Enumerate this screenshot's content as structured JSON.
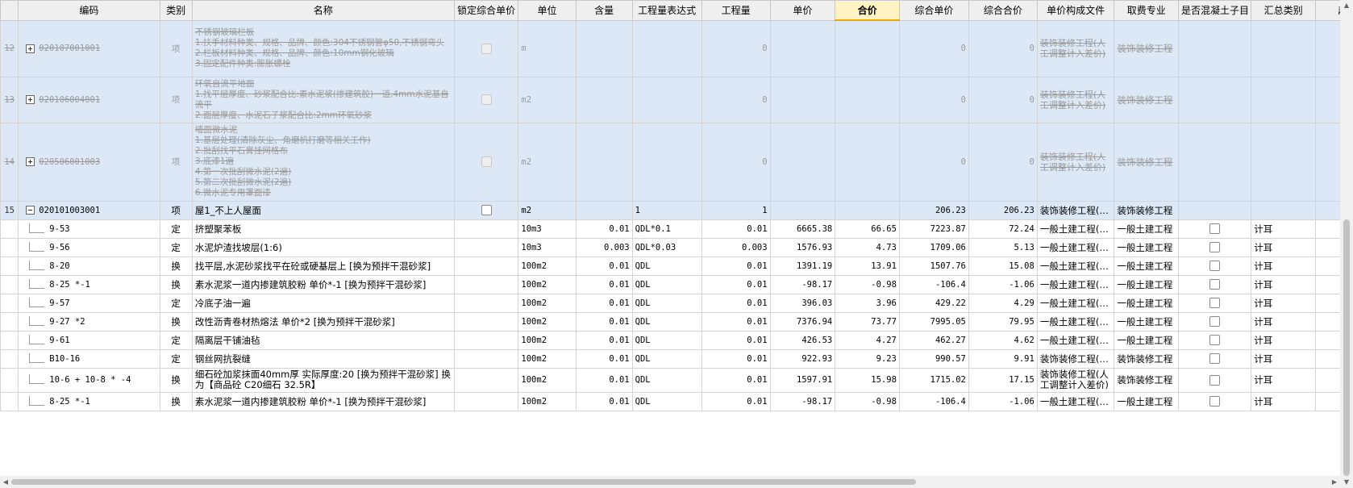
{
  "columns": [
    "编码",
    "类别",
    "名称",
    "锁定综合单价",
    "单位",
    "含量",
    "工程量表达式",
    "工程量",
    "单价",
    "合价",
    "综合单价",
    "综合合价",
    "单价构成文件",
    "取费专业",
    "是否混凝土子目",
    "汇总类别",
    "超"
  ],
  "parents": [
    {
      "no": "12",
      "code": "020107001001",
      "type": "项",
      "name": "不锈钢玻璃栏板\n1.扶手材料种类、规格、品牌、颜色:304不锈钢管φ50,不锈钢弯头\n2.栏板材料种类、规格、品牌、颜色:10mm钢化玻璃\n3.固定配件种类:膨胀螺栓",
      "unit": "m",
      "qty": "0",
      "comp_price": "0",
      "comp_total": "0",
      "file": "装饰装修工程(人工调整计入差价)",
      "prof": "装饰装修工程"
    },
    {
      "no": "13",
      "code": "020106004001",
      "type": "项",
      "name": "环氧自流平地面\n1.找平层厚度、砂浆配合比:素水泥浆(掺建筑胶)一道,4mm水泥基自流平\n2.面层厚度、水泥石子浆配合比:2mm环氧砂浆",
      "unit": "m2",
      "qty": "0",
      "comp_price": "0",
      "comp_total": "0",
      "file": "装饰装修工程(人工调整计入差价)",
      "prof": "装饰装修工程"
    },
    {
      "no": "14",
      "code": "020506001003",
      "type": "项",
      "name": "墙面微水泥\n1.基层处理(清除灰尘、角磨机打磨等相关工作)\n2.批刮找平石膏挂网格布\n3.底漆1遍\n4.第一次批刮微水泥(2遍)\n5.第二次批刮微水泥(2遍)\n6.微水泥专用罩面漆",
      "unit": "m2",
      "qty": "0",
      "comp_price": "0",
      "comp_total": "0",
      "file": "装饰装修工程(人工调整计入差价)",
      "prof": "装饰装修工程"
    }
  ],
  "row15": {
    "no": "15",
    "code": "020101003001",
    "type": "项",
    "name": "屋1_不上人屋面",
    "unit": "m2",
    "expr": "1",
    "qty": "1",
    "comp_price": "206.23",
    "comp_total": "206.23",
    "file": "装饰装修工程(…",
    "prof": "装饰装修工程"
  },
  "children": [
    {
      "code": "9-53",
      "type": "定",
      "name": "挤塑聚苯板",
      "unit": "10m3",
      "content": "0.01",
      "expr": "QDL*0.1",
      "qty": "0.01",
      "price": "6665.38",
      "total": "66.65",
      "comp_price": "7223.87",
      "comp_total": "72.24",
      "file": "一般土建工程(…",
      "prof": "一般土建工程",
      "sum": "计耳"
    },
    {
      "code": "9-56",
      "type": "定",
      "name": "水泥炉渣找坡层(1:6)",
      "unit": "10m3",
      "content": "0.003",
      "expr": "QDL*0.03",
      "qty": "0.003",
      "price": "1576.93",
      "total": "4.73",
      "comp_price": "1709.06",
      "comp_total": "5.13",
      "file": "一般土建工程(…",
      "prof": "一般土建工程",
      "sum": "计耳"
    },
    {
      "code": "8-20",
      "type": "换",
      "name": "找平层,水泥砂浆找平在砼或硬基层上 [换为预拌干混砂浆]",
      "unit": "100m2",
      "content": "0.01",
      "expr": "QDL",
      "qty": "0.01",
      "price": "1391.19",
      "total": "13.91",
      "comp_price": "1507.76",
      "comp_total": "15.08",
      "file": "一般土建工程(…",
      "prof": "一般土建工程",
      "sum": "计耳"
    },
    {
      "code": "8-25 *-1",
      "type": "换",
      "name": "素水泥浆一道内掺建筑胶粉 单价*-1 [换为预拌干混砂浆]",
      "unit": "100m2",
      "content": "0.01",
      "expr": "QDL",
      "qty": "0.01",
      "price": "-98.17",
      "total": "-0.98",
      "comp_price": "-106.4",
      "comp_total": "-1.06",
      "file": "一般土建工程(…",
      "prof": "一般土建工程",
      "sum": "计耳"
    },
    {
      "code": "9-57",
      "type": "定",
      "name": "冷底子油一遍",
      "unit": "100m2",
      "content": "0.01",
      "expr": "QDL",
      "qty": "0.01",
      "price": "396.03",
      "total": "3.96",
      "comp_price": "429.22",
      "comp_total": "4.29",
      "file": "一般土建工程(…",
      "prof": "一般土建工程",
      "sum": "计耳"
    },
    {
      "code": "9-27 *2",
      "type": "换",
      "name": "改性沥青卷材热熔法 单价*2 [换为预拌干混砂浆]",
      "unit": "100m2",
      "content": "0.01",
      "expr": "QDL",
      "qty": "0.01",
      "price": "7376.94",
      "total": "73.77",
      "comp_price": "7995.05",
      "comp_total": "79.95",
      "file": "一般土建工程(…",
      "prof": "一般土建工程",
      "sum": "计耳"
    },
    {
      "code": "9-61",
      "type": "定",
      "name": "隔离层干铺油毡",
      "unit": "100m2",
      "content": "0.01",
      "expr": "QDL",
      "qty": "0.01",
      "price": "426.53",
      "total": "4.27",
      "comp_price": "462.27",
      "comp_total": "4.62",
      "file": "一般土建工程(…",
      "prof": "一般土建工程",
      "sum": "计耳"
    },
    {
      "code": "B10-16",
      "type": "定",
      "name": "钢丝网抗裂缝",
      "unit": "100m2",
      "content": "0.01",
      "expr": "QDL",
      "qty": "0.01",
      "price": "922.93",
      "total": "9.23",
      "comp_price": "990.57",
      "comp_total": "9.91",
      "file": "装饰装修工程(…",
      "prof": "装饰装修工程",
      "sum": "计耳"
    },
    {
      "code": "10-6 + 10-8 * -4",
      "type": "换",
      "name": "细石砼加浆抹面40mm厚 实际厚度:20 [换为预拌干混砂浆] 换为【商品砼 C20细石 32.5R】",
      "unit": "100m2",
      "content": "0.01",
      "expr": "QDL",
      "qty": "0.01",
      "price": "1597.91",
      "total": "15.98",
      "comp_price": "1715.02",
      "comp_total": "17.15",
      "file": "装饰装修工程(人工调整计入差价)",
      "prof": "装饰装修工程",
      "sum": "计耳"
    },
    {
      "code": "8-25 *-1",
      "type": "换",
      "name": "素水泥浆一道内掺建筑胶粉 单价*-1 [换为预拌干混砂浆]",
      "unit": "100m2",
      "content": "0.01",
      "expr": "QDL",
      "qty": "0.01",
      "price": "-98.17",
      "total": "-0.98",
      "comp_price": "-106.4",
      "comp_total": "-1.06",
      "file": "一般土建工程(…",
      "prof": "一般土建工程",
      "sum": "计耳"
    }
  ],
  "icons": {
    "expand": "plus-box-icon",
    "collapse": "minus-box-icon",
    "left": "arrow-left-icon",
    "right": "arrow-right-icon",
    "up": "arrow-up-icon",
    "down": "arrow-down-icon"
  },
  "colors": {
    "parent_bg": "#dde8f6",
    "active_header": "#fff3c4"
  }
}
